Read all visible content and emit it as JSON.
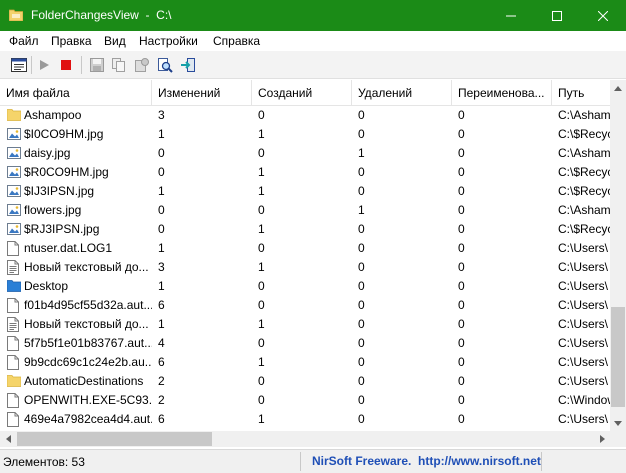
{
  "window": {
    "title": "FolderChangesView  -  C:\\",
    "titlebar_color": "#1b8b17"
  },
  "menu": [
    "Файл",
    "Правка",
    "Вид",
    "Настройки",
    "Справка"
  ],
  "toolbar": {
    "icons": [
      "properties-icon",
      "play-icon",
      "stop-icon",
      "save-icon",
      "copy-icon",
      "html-report-icon",
      "find-icon",
      "exit-icon"
    ]
  },
  "table": {
    "columns": [
      "Имя файла",
      "Изменений",
      "Созданий",
      "Удалений",
      "Переименова...",
      "Путь"
    ],
    "rows": [
      {
        "icon": "folder-icon",
        "name": "Ashampoo",
        "c1": "3",
        "c2": "0",
        "c3": "0",
        "c4": "0",
        "path": "C:\\Ashampoo"
      },
      {
        "icon": "image-file-icon",
        "name": "$I0CO9HM.jpg",
        "c1": "1",
        "c2": "1",
        "c3": "0",
        "c4": "0",
        "path": "C:\\$Recycle.Bin"
      },
      {
        "icon": "image-file-icon",
        "name": "daisy.jpg",
        "c1": "0",
        "c2": "0",
        "c3": "1",
        "c4": "0",
        "path": "C:\\Ashampoo"
      },
      {
        "icon": "image-file-icon",
        "name": "$R0CO9HM.jpg",
        "c1": "0",
        "c2": "1",
        "c3": "0",
        "c4": "0",
        "path": "C:\\$Recycle.Bin"
      },
      {
        "icon": "image-file-icon",
        "name": "$IJ3IPSN.jpg",
        "c1": "1",
        "c2": "1",
        "c3": "0",
        "c4": "0",
        "path": "C:\\$Recycle.Bin"
      },
      {
        "icon": "image-file-icon",
        "name": "flowers.jpg",
        "c1": "0",
        "c2": "0",
        "c3": "1",
        "c4": "0",
        "path": "C:\\Ashampoo"
      },
      {
        "icon": "image-file-icon",
        "name": "$RJ3IPSN.jpg",
        "c1": "0",
        "c2": "1",
        "c3": "0",
        "c4": "0",
        "path": "C:\\$Recycle.Bin"
      },
      {
        "icon": "file-icon",
        "name": "ntuser.dat.LOG1",
        "c1": "1",
        "c2": "0",
        "c3": "0",
        "c4": "0",
        "path": "C:\\Users\\"
      },
      {
        "icon": "text-file-icon",
        "name": "Новый текстовый до...",
        "c1": "3",
        "c2": "1",
        "c3": "0",
        "c4": "0",
        "path": "C:\\Users\\"
      },
      {
        "icon": "desktop-folder-icon",
        "name": "Desktop",
        "c1": "1",
        "c2": "0",
        "c3": "0",
        "c4": "0",
        "path": "C:\\Users\\"
      },
      {
        "icon": "file-icon",
        "name": "f01b4d95cf55d32a.aut...",
        "c1": "6",
        "c2": "0",
        "c3": "0",
        "c4": "0",
        "path": "C:\\Users\\"
      },
      {
        "icon": "text-file-icon",
        "name": "Новый текстовый до...",
        "c1": "1",
        "c2": "1",
        "c3": "0",
        "c4": "0",
        "path": "C:\\Users\\"
      },
      {
        "icon": "file-icon",
        "name": "5f7b5f1e01b83767.aut...",
        "c1": "4",
        "c2": "0",
        "c3": "0",
        "c4": "0",
        "path": "C:\\Users\\"
      },
      {
        "icon": "file-icon",
        "name": "9b9cdc69c1c24e2b.au...",
        "c1": "6",
        "c2": "1",
        "c3": "0",
        "c4": "0",
        "path": "C:\\Users\\"
      },
      {
        "icon": "folder-icon",
        "name": "AutomaticDestinations",
        "c1": "2",
        "c2": "0",
        "c3": "0",
        "c4": "0",
        "path": "C:\\Users\\"
      },
      {
        "icon": "file-icon",
        "name": "OPENWITH.EXE-5C93...",
        "c1": "2",
        "c2": "0",
        "c3": "0",
        "c4": "0",
        "path": "C:\\Windows\\"
      },
      {
        "icon": "file-icon",
        "name": "469e4a7982cea4d4.aut...",
        "c1": "6",
        "c2": "1",
        "c3": "0",
        "c4": "0",
        "path": "C:\\Users\\"
      }
    ]
  },
  "status": {
    "count": "Элементов: 53",
    "link": "NirSoft Freeware.  http://www.nirsoft.net",
    "link_color": "#1f4fb6"
  }
}
